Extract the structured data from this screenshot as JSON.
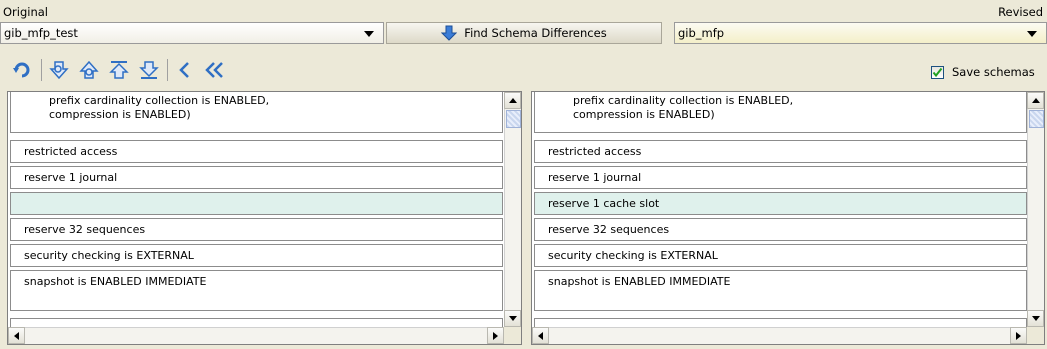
{
  "header": {
    "original_label": "Original",
    "revised_label": "Revised"
  },
  "schemas": {
    "original_value": "gib_mfp_test",
    "revised_value": "gib_mfp",
    "find_button_label": "Find Schema Differences"
  },
  "toolbar": {
    "buttons": [
      "undo-icon",
      "next-difference-icon",
      "previous-difference-icon",
      "first-difference-icon",
      "last-difference-icon",
      "copy-left-icon",
      "copy-all-left-icon"
    ],
    "save_schemas_label": "Save schemas",
    "save_schemas_checked": true
  },
  "original_panel": {
    "rows": [
      {
        "line1": "prefix cardinality collection is ENABLED,",
        "line2": "compression is ENABLED)"
      },
      {
        "text": "restricted access"
      },
      {
        "text": "reserve 1 journal"
      },
      {
        "text": ""
      },
      {
        "text": "reserve 32 sequences"
      },
      {
        "text": "security checking is EXTERNAL"
      },
      {
        "text": "snapshot is ENABLED IMMEDIATE"
      },
      {
        "text": ""
      }
    ]
  },
  "revised_panel": {
    "rows": [
      {
        "line1": "prefix cardinality collection is ENABLED,",
        "line2": "compression is ENABLED)"
      },
      {
        "text": "restricted access"
      },
      {
        "text": "reserve 1 journal"
      },
      {
        "text": "reserve 1 cache slot"
      },
      {
        "text": "reserve 32 sequences"
      },
      {
        "text": "security checking is EXTERNAL"
      },
      {
        "text": "snapshot is ENABLED IMMEDIATE"
      },
      {
        "text": ""
      }
    ]
  },
  "colors": {
    "changed_row": "#dff1ec",
    "icon_blue": "#2f6fc4",
    "check_green": "#21a121"
  }
}
